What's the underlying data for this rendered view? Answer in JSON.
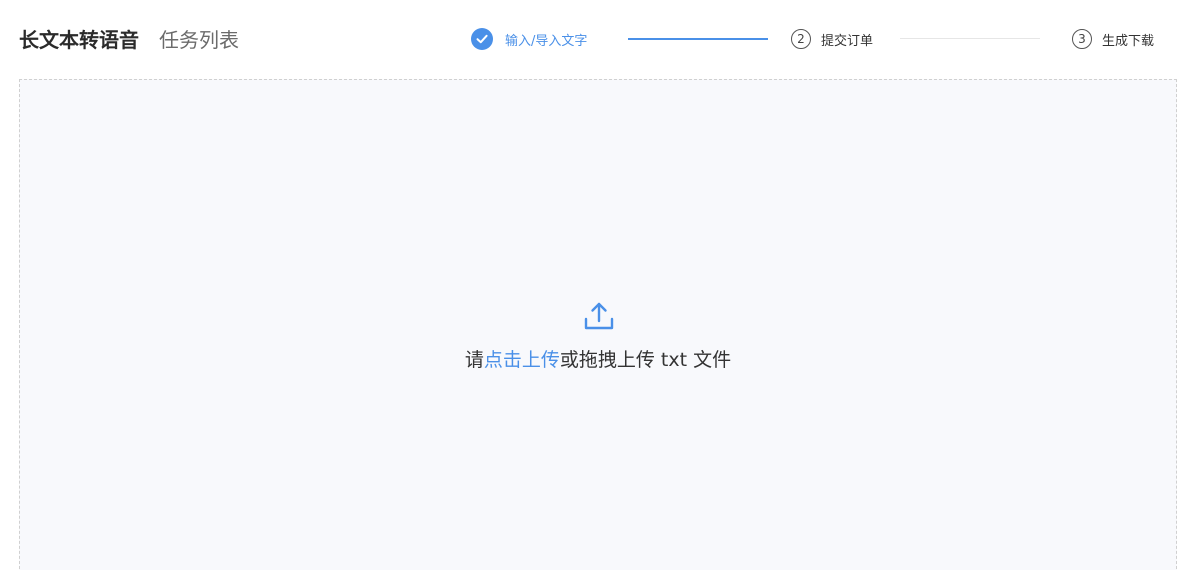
{
  "header": {
    "tabs": [
      {
        "label": "长文本转语音"
      },
      {
        "label": "任务列表"
      }
    ]
  },
  "steps": [
    {
      "label": "输入/导入文字",
      "status": "done",
      "icon": "check-icon"
    },
    {
      "number": "2",
      "label": "提交订单",
      "status": "pending"
    },
    {
      "number": "3",
      "label": "生成下载",
      "status": "pending"
    }
  ],
  "upload": {
    "icon": "upload-icon",
    "prefix": "请",
    "link": "点击上传",
    "suffix": "或拖拽上传 txt 文件"
  },
  "colors": {
    "accent": "#4a90e8",
    "upload_bg": "#f8f9fc",
    "border": "#d0d0d0"
  }
}
